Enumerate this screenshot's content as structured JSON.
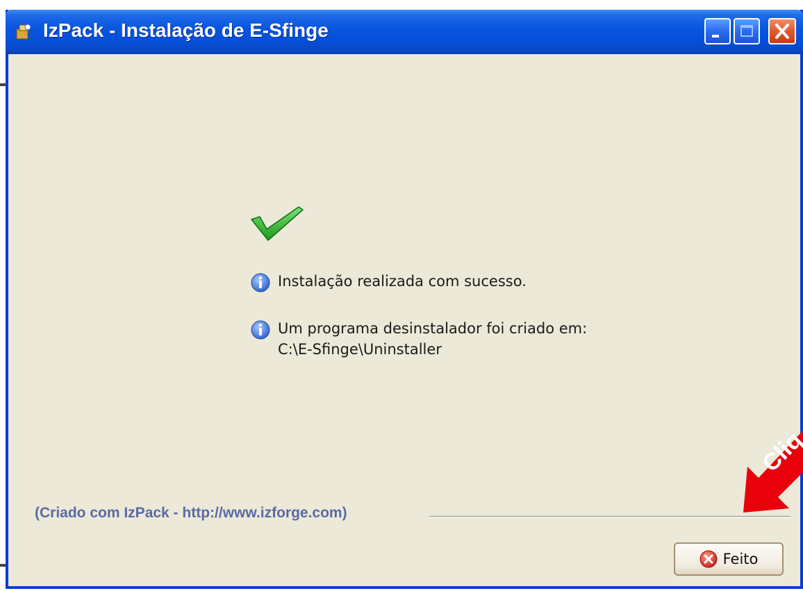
{
  "window": {
    "title": "IzPack - Instalação de E-Sfinge"
  },
  "messages": {
    "success": "Instalação realizada com sucesso.",
    "uninstaller_line1": "Um programa desinstalador foi criado em:",
    "uninstaller_path": "C:\\E-Sfinge\\Uninstaller"
  },
  "footer": {
    "credit": "(Criado com IzPack - http://www.izforge.com)",
    "done_label": "Feito"
  },
  "annotation": {
    "text": "Cliq"
  },
  "colors": {
    "titlebar": "#0a56e0",
    "window_bg": "#ece9d8",
    "credit_text": "#5a6aa6",
    "arrow": "#e8000a",
    "check_green": "#2bb52b",
    "close_button": "#e05a2c"
  },
  "icons": {
    "app": "izpack-app-icon",
    "success": "check-icon",
    "info": "info-icon",
    "done": "close-circle-icon"
  }
}
